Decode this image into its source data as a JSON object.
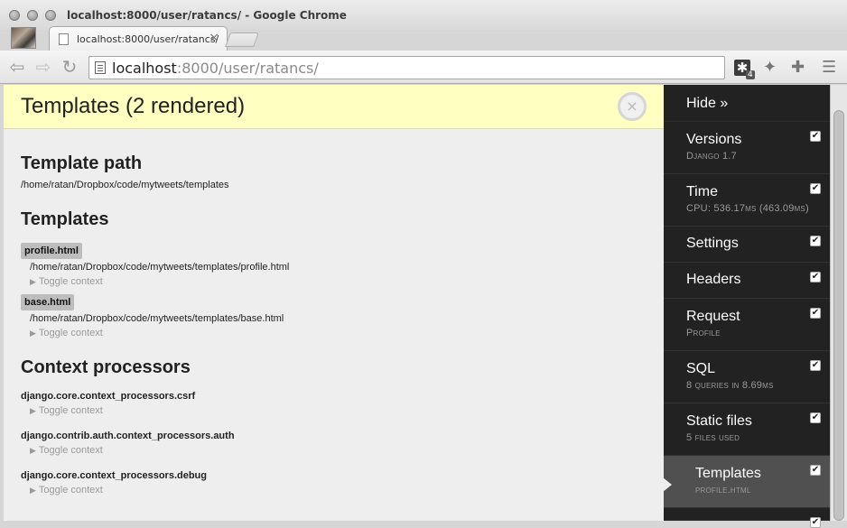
{
  "window": {
    "title": "localhost:8000/user/ratancs/ - Google Chrome"
  },
  "tab": {
    "title": "localhost:8000/user/ratancs/",
    "close": "×"
  },
  "omnibox": {
    "host": "localhost",
    "rest": ":8000/user/ratancs/"
  },
  "extension": {
    "badge": "4"
  },
  "panel": {
    "title": "Templates (2 rendered)",
    "close_glyph": "×",
    "template_path_heading": "Template path",
    "template_path": "/home/ratan/Dropbox/code/mytweets/templates",
    "templates_heading": "Templates",
    "templates": [
      {
        "name": "profile.html",
        "path": "/home/ratan/Dropbox/code/mytweets/templates/profile.html",
        "toggle": "Toggle context"
      },
      {
        "name": "base.html",
        "path": "/home/ratan/Dropbox/code/mytweets/templates/base.html",
        "toggle": "Toggle context"
      }
    ],
    "context_heading": "Context processors",
    "processors": [
      {
        "name": "django.core.context_processors.csrf",
        "toggle": "Toggle context"
      },
      {
        "name": "django.contrib.auth.context_processors.auth",
        "toggle": "Toggle context"
      },
      {
        "name": "django.core.context_processors.debug",
        "toggle": "Toggle context"
      }
    ]
  },
  "djdt": {
    "hide": "Hide »",
    "items": [
      {
        "label": "Versions",
        "sub": "Django 1.7"
      },
      {
        "label": "Time",
        "sub": "CPU: 536.17ms (463.09ms)"
      },
      {
        "label": "Settings",
        "sub": ""
      },
      {
        "label": "Headers",
        "sub": ""
      },
      {
        "label": "Request",
        "sub": "Profile"
      },
      {
        "label": "SQL",
        "sub": "8 queries in 8.69ms"
      },
      {
        "label": "Static files",
        "sub": "5 files used"
      },
      {
        "label": "Templates",
        "sub": "profile.html"
      }
    ]
  }
}
